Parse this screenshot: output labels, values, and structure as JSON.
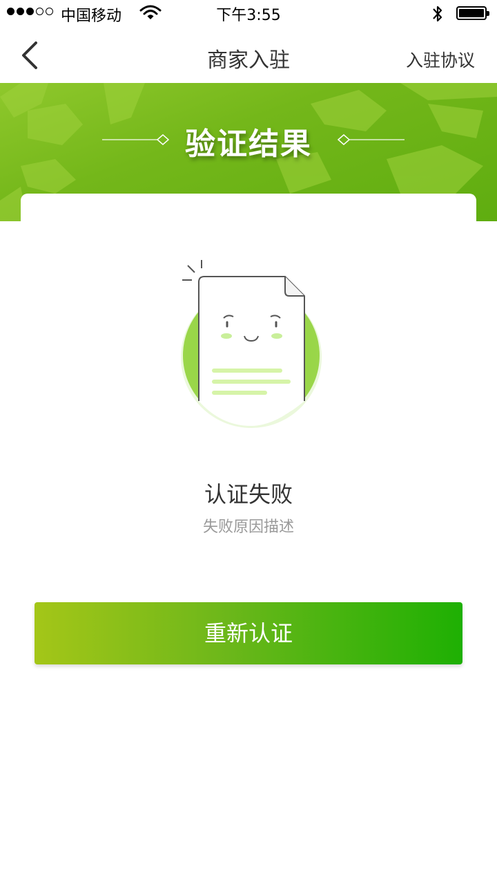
{
  "status_bar": {
    "carrier": "中国移动",
    "time": "下午3:55"
  },
  "nav": {
    "title": "商家入驻",
    "agreement_label": "入驻协议",
    "back_icon": "chevron-left-icon"
  },
  "banner": {
    "title": "验证结果"
  },
  "result": {
    "title": "认证失败",
    "description": "失败原因描述"
  },
  "actions": {
    "retry_label": "重新认证"
  },
  "colors": {
    "brand_green": "#5fad10",
    "button_start": "#a4c618",
    "button_end": "#1eb003",
    "light_green": "#d6f4a8"
  }
}
